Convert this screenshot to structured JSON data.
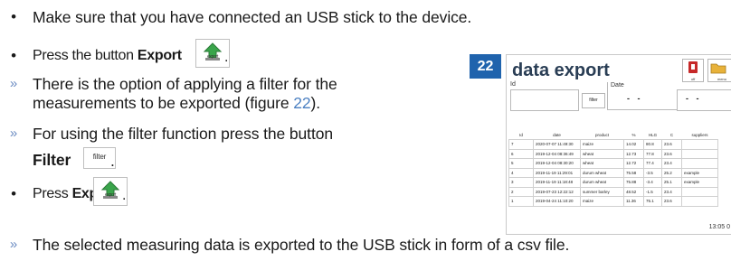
{
  "steps": {
    "usb": "Make sure that you have connected an USB stick to the device.",
    "press_btn": "Press the button",
    "export_bold": "Export",
    "export_cap": "export",
    "option_1": "There is the option of applying a filter for the",
    "option_2a": "measurements to be exported (figure ",
    "option_fig": "22",
    "option_2b": ").",
    "filter_1": "For using the filter function press the button",
    "filter_bold": "Filter",
    "filter_btn": "filter",
    "press": "Press",
    "result": "The selected measuring data is exported to the USB stick in form of a csv file."
  },
  "figure": {
    "number": "22",
    "title": "data export",
    "buttons": {
      "off": "off",
      "menu": "menu"
    },
    "id_label": "Id",
    "date_label": "Date",
    "filter_label": "filter",
    "dashes": "- -",
    "columns": [
      "Id",
      "date",
      "product",
      "%",
      "HLG",
      "C",
      "suppliers"
    ],
    "rows": [
      [
        "7",
        "2020-07-07 11:49:30",
        "maize",
        "14.02",
        "80.8",
        "23.6",
        ""
      ],
      [
        "6",
        "2019-12-04 08:36:49",
        "wheat",
        "12.73",
        "77.8",
        "23.6",
        ""
      ],
      [
        "5",
        "2019-12-04 08:30:20",
        "wheat",
        "12.72",
        "77.4",
        "23.4",
        ""
      ],
      [
        "4",
        "2019-11-19 11:29:01",
        "durum wheat",
        "75.58",
        "-3.5",
        "25.2",
        "example"
      ],
      [
        "3",
        "2019-11-19 11:18:48",
        "durum wheat",
        "75.88",
        "-3.4",
        "25.1",
        "example"
      ],
      [
        "2",
        "2019-07-23 12:22:12",
        "summer barley",
        "48.52",
        "-1.5",
        "23.4",
        ""
      ],
      [
        "1",
        "2019-04-24 11:10:20",
        "maize",
        "11.36",
        "75.1",
        "23.6",
        ""
      ]
    ],
    "clock": "13:05 0"
  },
  "colors": {
    "badge": "#1f63ad",
    "link": "#4a7fc1",
    "chevron": "#6b8cc2"
  }
}
